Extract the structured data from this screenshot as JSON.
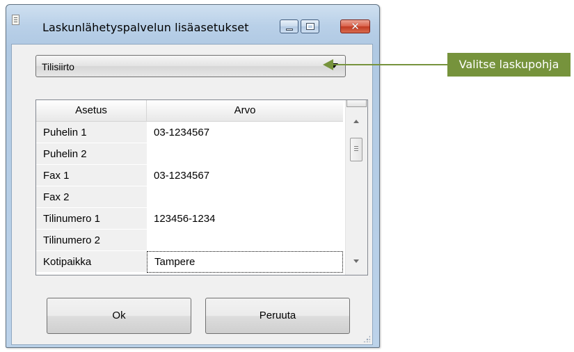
{
  "window": {
    "title": "Laskunlähetyspalvelun lisäasetukset",
    "controls": {
      "minimize": "minimize-icon",
      "maximize": "maximize-icon",
      "close": "close-icon",
      "close_glyph": "✕"
    }
  },
  "template_select": {
    "value": "Tilisiirto"
  },
  "grid": {
    "columns": [
      "Asetus",
      "Arvo"
    ],
    "rows": [
      {
        "setting": "Puhelin 1",
        "value": "03-1234567"
      },
      {
        "setting": "Puhelin 2",
        "value": ""
      },
      {
        "setting": "Fax 1",
        "value": "03-1234567"
      },
      {
        "setting": "Fax 2",
        "value": ""
      },
      {
        "setting": "Tilinumero 1",
        "value": "123456-1234"
      },
      {
        "setting": "Tilinumero 2",
        "value": ""
      },
      {
        "setting": "Kotipaikka",
        "value": "Tampere"
      }
    ]
  },
  "buttons": {
    "ok": "Ok",
    "cancel": "Peruuta"
  },
  "annotation": {
    "text": "Valitse laskupohja",
    "color": "#76933c"
  }
}
